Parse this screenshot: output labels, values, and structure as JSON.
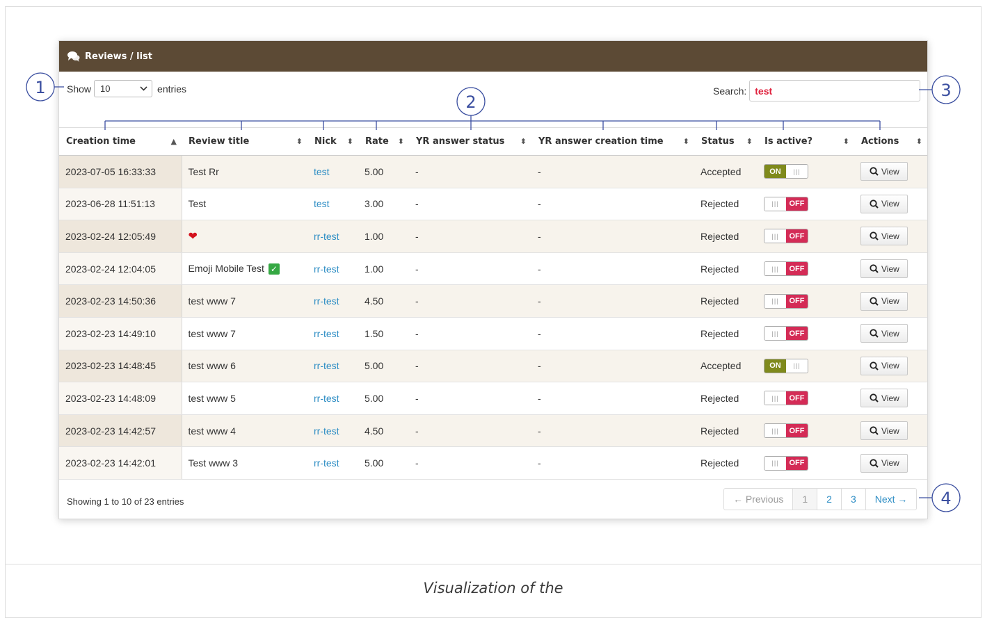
{
  "header": {
    "title": "Reviews / list"
  },
  "controls": {
    "show_label": "Show",
    "show_value": "10",
    "entries_label": "entries",
    "search_label": "Search:",
    "search_value": "test"
  },
  "columns": [
    "Creation time",
    "Review title",
    "Nick",
    "Rate",
    "YR answer status",
    "YR answer creation time",
    "Status",
    "Is active?",
    "Actions"
  ],
  "rows": [
    {
      "time": "2023-07-05 16:33:33",
      "title": "Test Rr",
      "nick": "test",
      "rate": "5.00",
      "yr_status": "-",
      "yr_time": "-",
      "status": "Accepted",
      "active": "ON"
    },
    {
      "time": "2023-06-28 11:51:13",
      "title": "Test",
      "nick": "test",
      "rate": "3.00",
      "yr_status": "-",
      "yr_time": "-",
      "status": "Rejected",
      "active": "OFF"
    },
    {
      "time": "2023-02-24 12:05:49",
      "title": "❤",
      "nick": "rr-test",
      "rate": "1.00",
      "yr_status": "-",
      "yr_time": "-",
      "status": "Rejected",
      "active": "OFF"
    },
    {
      "time": "2023-02-24 12:04:05",
      "title": "Emoji Mobile Test",
      "nick": "rr-test",
      "rate": "1.00",
      "yr_status": "-",
      "yr_time": "-",
      "status": "Rejected",
      "active": "OFF"
    },
    {
      "time": "2023-02-23 14:50:36",
      "title": "test www 7",
      "nick": "rr-test",
      "rate": "4.50",
      "yr_status": "-",
      "yr_time": "-",
      "status": "Rejected",
      "active": "OFF"
    },
    {
      "time": "2023-02-23 14:49:10",
      "title": "test www 7",
      "nick": "rr-test",
      "rate": "1.50",
      "yr_status": "-",
      "yr_time": "-",
      "status": "Rejected",
      "active": "OFF"
    },
    {
      "time": "2023-02-23 14:48:45",
      "title": "test www 6",
      "nick": "rr-test",
      "rate": "5.00",
      "yr_status": "-",
      "yr_time": "-",
      "status": "Accepted",
      "active": "ON"
    },
    {
      "time": "2023-02-23 14:48:09",
      "title": "test www 5",
      "nick": "rr-test",
      "rate": "5.00",
      "yr_status": "-",
      "yr_time": "-",
      "status": "Rejected",
      "active": "OFF"
    },
    {
      "time": "2023-02-23 14:42:57",
      "title": "test www 4",
      "nick": "rr-test",
      "rate": "4.50",
      "yr_status": "-",
      "yr_time": "-",
      "status": "Rejected",
      "active": "OFF"
    },
    {
      "time": "2023-02-23 14:42:01",
      "title": "Test www 3",
      "nick": "rr-test",
      "rate": "5.00",
      "yr_status": "-",
      "yr_time": "-",
      "status": "Rejected",
      "active": "OFF"
    }
  ],
  "view_label": "View",
  "footer": {
    "info": "Showing 1 to 10 of 23 entries",
    "pages": [
      "← Previous",
      "1",
      "2",
      "3",
      "Next →"
    ]
  },
  "callouts": [
    "1",
    "2",
    "3",
    "4"
  ],
  "caption": "Visualization of the",
  "colors": {
    "header": "#5c4a35",
    "on": "#7f8a1c",
    "off": "#d42b56",
    "link": "#2d8dc4",
    "search_text": "#e0213d"
  }
}
